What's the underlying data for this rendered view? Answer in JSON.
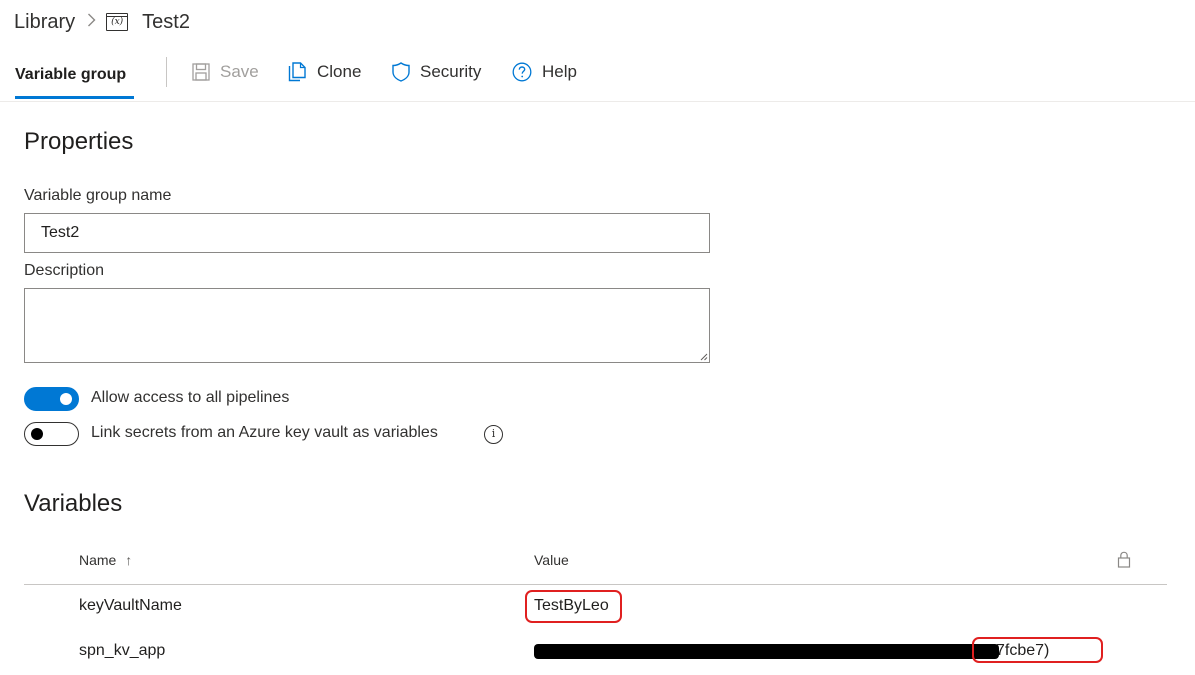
{
  "breadcrumb": {
    "library": "Library",
    "separator": ">",
    "icon": "variable-group-icon",
    "icon_glyph": "(x)",
    "title": "Test2"
  },
  "toolbar": {
    "tab_label": "Variable group",
    "save_label": "Save",
    "clone_label": "Clone",
    "security_label": "Security",
    "help_label": "Help",
    "accent_color": "#0078d4"
  },
  "properties": {
    "section_title": "Properties",
    "group_name_label": "Variable group name",
    "group_name_value": "Test2",
    "description_label": "Description",
    "description_value": "",
    "allow_access_label": "Allow access to all pipelines",
    "allow_access_on": true,
    "link_keyvault_label": "Link secrets from an Azure key vault as variables",
    "link_keyvault_on": false,
    "info_glyph": "i"
  },
  "variables": {
    "section_title": "Variables",
    "columns": {
      "name": "Name",
      "sort_indicator": "↑",
      "value": "Value",
      "lock": "lock-icon"
    },
    "rows": [
      {
        "name": "keyVaultName",
        "value": "TestByLeo"
      },
      {
        "name": "spn_kv_app",
        "value_visible_suffix": "7fcbe7)",
        "value_redacted": true
      }
    ],
    "annotation_color": "#e02020"
  }
}
